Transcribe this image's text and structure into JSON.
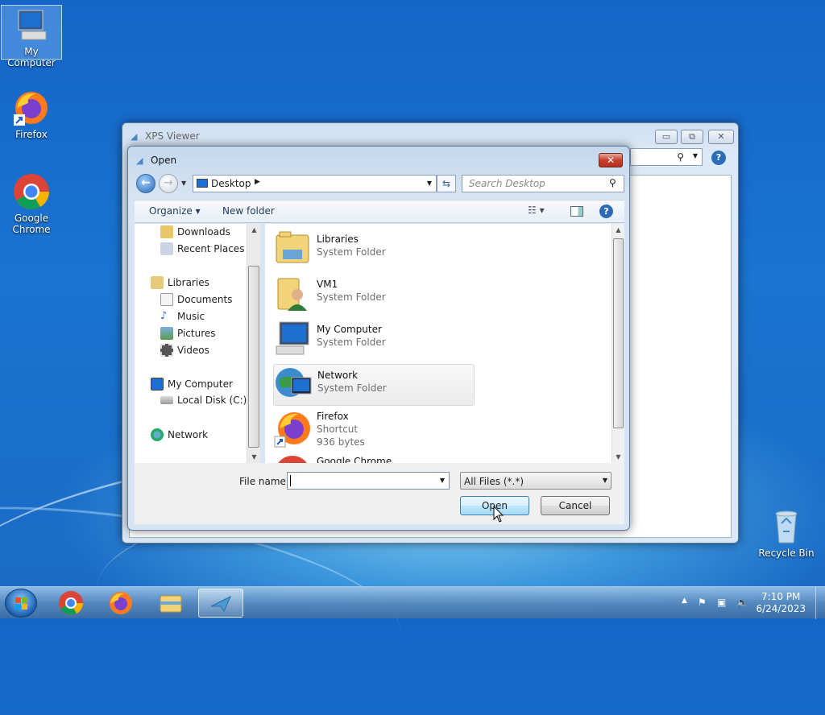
{
  "desktop": {
    "icons": [
      {
        "label": "My Computer",
        "icon": "computer-icon"
      },
      {
        "label": "Firefox",
        "icon": "firefox-icon"
      },
      {
        "label": "Google Chrome",
        "icon": "chrome-icon"
      },
      {
        "label": "Recycle Bin",
        "icon": "recycle-bin-icon"
      }
    ]
  },
  "xps_viewer": {
    "title": "XPS Viewer",
    "min": "▭",
    "max": "⧉",
    "close": "✕"
  },
  "dialog": {
    "title": "Open",
    "close": "✕",
    "address": {
      "path": "Desktop"
    },
    "search": {
      "placeholder": "Search Desktop"
    },
    "toolbar": {
      "organize": "Organize ▾",
      "new_folder": "New folder",
      "help": "?"
    },
    "nav": [
      {
        "label": "Downloads",
        "icon": "downloads-folder-icon"
      },
      {
        "label": "Recent Places",
        "icon": "recent-places-icon"
      },
      {
        "label": "Libraries",
        "icon": "libraries-icon"
      },
      {
        "label": "Documents",
        "icon": "documents-icon"
      },
      {
        "label": "Music",
        "icon": "music-icon"
      },
      {
        "label": "Pictures",
        "icon": "pictures-icon"
      },
      {
        "label": "Videos",
        "icon": "videos-icon"
      },
      {
        "label": "My Computer",
        "icon": "computer-icon"
      },
      {
        "label": "Local Disk (C:)",
        "icon": "disk-icon"
      },
      {
        "label": "Network",
        "icon": "network-icon"
      }
    ],
    "files": [
      {
        "name": "Libraries",
        "type": "System Folder",
        "icon": "libraries-folder-icon"
      },
      {
        "name": "VM1",
        "type": "System Folder",
        "icon": "user-folder-icon"
      },
      {
        "name": "My Computer",
        "type": "System Folder",
        "icon": "computer-icon"
      },
      {
        "name": "Network",
        "type": "System Folder",
        "icon": "network-icon",
        "selected": true
      },
      {
        "name": "Firefox",
        "type": "Shortcut",
        "size": "936 bytes",
        "icon": "firefox-icon"
      },
      {
        "name": "Google Chrome",
        "type": "",
        "icon": "chrome-icon"
      }
    ],
    "file_name": {
      "label": "File name:",
      "value": ""
    },
    "filter": {
      "value": "All Files (*.*)"
    },
    "open_label": "Open",
    "cancel_label": "Cancel"
  },
  "taskbar": {
    "time": "7:10 PM",
    "date": "6/24/2023"
  },
  "colors": {
    "accent": "#3c7fb1",
    "desktop": "#1a6fcb",
    "close": "#c7402b"
  }
}
